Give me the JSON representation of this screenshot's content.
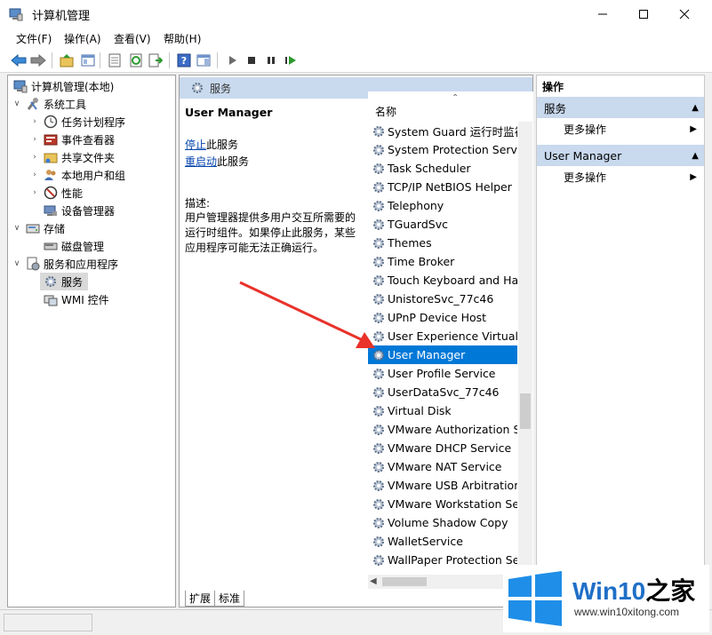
{
  "window": {
    "title": "计算机管理"
  },
  "menu": [
    "文件(F)",
    "操作(A)",
    "查看(V)",
    "帮助(H)"
  ],
  "tree": {
    "root": "计算机管理(本地)",
    "system_tools": "系统工具",
    "task_scheduler": "任务计划程序",
    "event_viewer": "事件查看器",
    "shared_folders": "共享文件夹",
    "local_users": "本地用户和组",
    "performance": "性能",
    "device_manager": "设备管理器",
    "storage": "存储",
    "disk_management": "磁盘管理",
    "services_apps": "服务和应用程序",
    "services": "服务",
    "wmi": "WMI 控件"
  },
  "middle": {
    "header": "服务",
    "service_name": "User Manager",
    "stop_link": "停止",
    "stop_suffix": "此服务",
    "restart_link": "重启动",
    "restart_suffix": "此服务",
    "desc_label": "描述:",
    "desc_text": "用户管理器提供多用户交互所需要的运行时组件。如果停止此服务，某些应用程序可能无法正确运行。",
    "column_name": "名称",
    "services": [
      "System Guard 运行时监视",
      "System Protection Service",
      "Task Scheduler",
      "TCP/IP NetBIOS Helper",
      "Telephony",
      "TGuardSvc",
      "Themes",
      "Time Broker",
      "Touch Keyboard and Ha...",
      "UnistoreSvc_77c46",
      "UPnP Device Host",
      "User Experience Virtualiz",
      "User Manager",
      "User Profile Service",
      "UserDataSvc_77c46",
      "Virtual Disk",
      "VMware Authorization Se",
      "VMware DHCP Service",
      "VMware NAT Service",
      "VMware USB Arbitration",
      "VMware Workstation Ser",
      "Volume Shadow Copy",
      "WalletService",
      "WallPaper Protection Ser"
    ],
    "selected_index": 12,
    "tabs": [
      "扩展",
      "标准"
    ]
  },
  "actions": {
    "header": "操作",
    "section1": "服务",
    "more1": "更多操作",
    "section2": "User Manager",
    "more2": "更多操作"
  },
  "watermark": {
    "brand": "Win10",
    "brand_suffix": "之家",
    "url": "www.win10xitong.com"
  },
  "colors": {
    "selection": "#0078d7",
    "header_bar": "#c9d9ee",
    "arrow": "#e8322b"
  }
}
